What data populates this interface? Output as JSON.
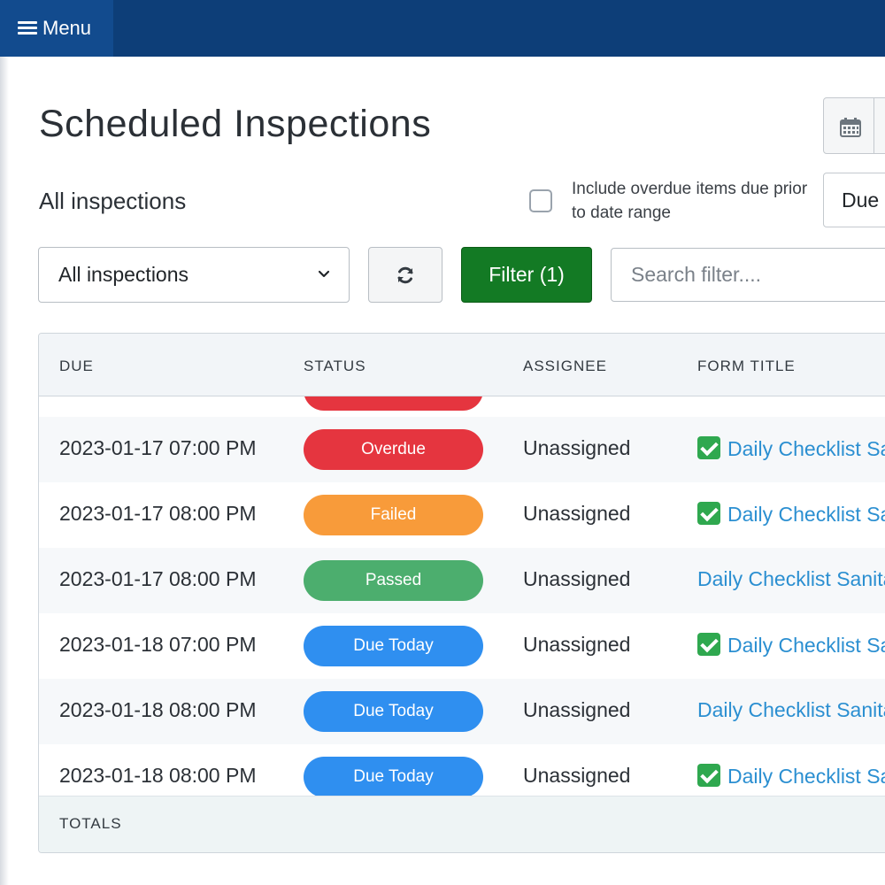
{
  "nav": {
    "menu_label": "Menu"
  },
  "header": {
    "title": "Scheduled Inspections",
    "subtitle": "All inspections",
    "overdue_checkbox_label": "Include overdue items due prior to date range",
    "overdue_checked": false,
    "due_select_value": "Due"
  },
  "toolbar": {
    "inspections_select_value": "All inspections",
    "filter_label": "Filter (1)",
    "search_placeholder": "Search filter...."
  },
  "table": {
    "columns": [
      "DUE",
      "STATUS",
      "ASSIGNEE",
      "FORM TITLE"
    ],
    "rows": [
      {
        "due": "2023-01-17 07:00 PM",
        "status": "Overdue",
        "status_color": "#e5353f",
        "assignee": "Unassigned",
        "form_title": "Daily Checklist Sa",
        "checked": true
      },
      {
        "due": "2023-01-17 08:00 PM",
        "status": "Failed",
        "status_color": "#f89b3a",
        "assignee": "Unassigned",
        "form_title": "Daily Checklist Sa",
        "checked": true
      },
      {
        "due": "2023-01-17 08:00 PM",
        "status": "Passed",
        "status_color": "#4cae6e",
        "assignee": "Unassigned",
        "form_title": "Daily Checklist Sanita",
        "checked": false
      },
      {
        "due": "2023-01-18 07:00 PM",
        "status": "Due Today",
        "status_color": "#2f8ff0",
        "assignee": "Unassigned",
        "form_title": "Daily Checklist Sa",
        "checked": true
      },
      {
        "due": "2023-01-18 08:00 PM",
        "status": "Due Today",
        "status_color": "#2f8ff0",
        "assignee": "Unassigned",
        "form_title": "Daily Checklist Sanita",
        "checked": false
      },
      {
        "due": "2023-01-18 08:00 PM",
        "status": "Due Today",
        "status_color": "#2f8ff0",
        "assignee": "Unassigned",
        "form_title": "Daily Checklist Sa",
        "checked": true
      }
    ],
    "totals_label": "TOTALS"
  },
  "icons": {
    "menu": "hamburger-icon",
    "calendar": "calendar-icon",
    "chevron": "chevron-down-icon",
    "refresh": "refresh-icon",
    "check": "check-mark-icon"
  },
  "colors": {
    "nav_bg": "#0d3e78",
    "filter_btn": "#137a24",
    "link": "#2b8fd1"
  }
}
